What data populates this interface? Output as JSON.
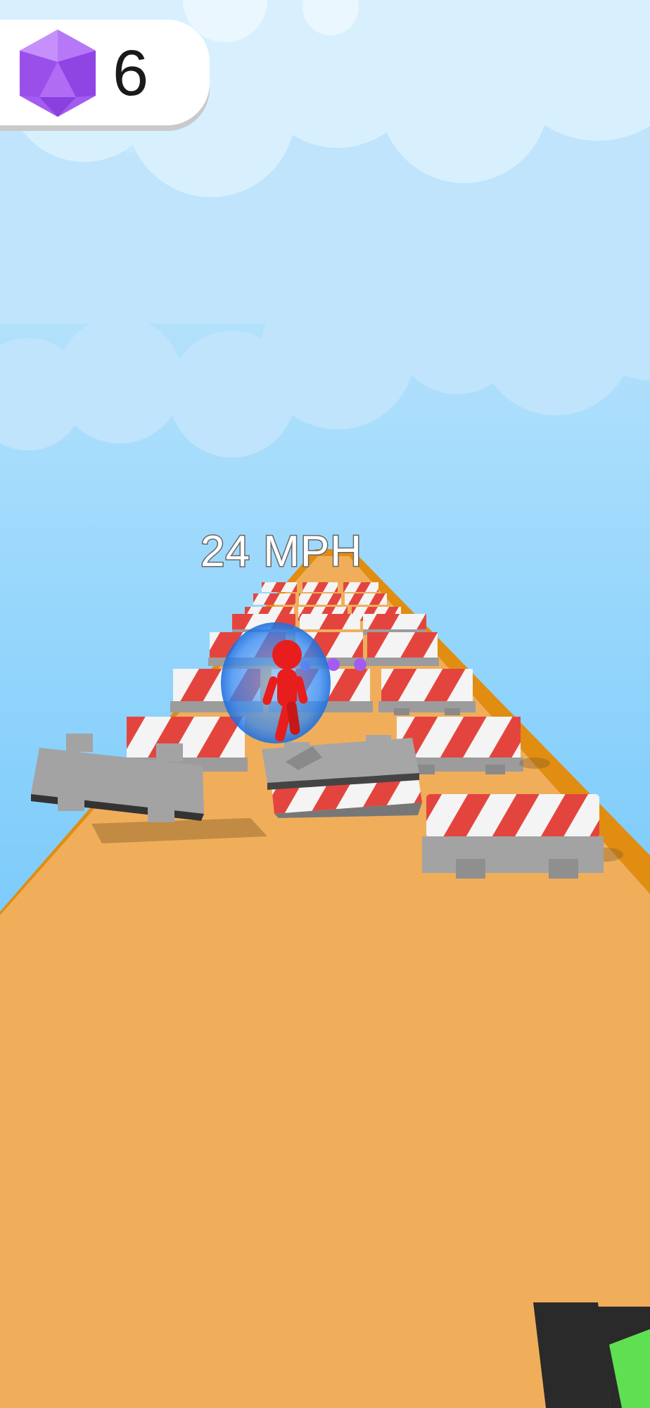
{
  "hud": {
    "gem_count": "6",
    "gem_icon": "purple-gem-icon",
    "speed_text": "24 MPH"
  },
  "colors": {
    "sky_top": "#d2edfd",
    "sky_bottom": "#55b9f8",
    "cloud": "#bfe4fc",
    "road": "#f0ae5b",
    "road_edge": "#e08d12",
    "barrier_stripe_red": "#e3453e",
    "barrier_white": "#f4f4f4",
    "barrier_base": "#9c9c9c",
    "player": "#e81e1e",
    "shield": "#2f86f3",
    "gem": "#a45cf0",
    "corner_prop_dark": "#2a2a2a",
    "corner_prop_green": "#5fe052"
  }
}
